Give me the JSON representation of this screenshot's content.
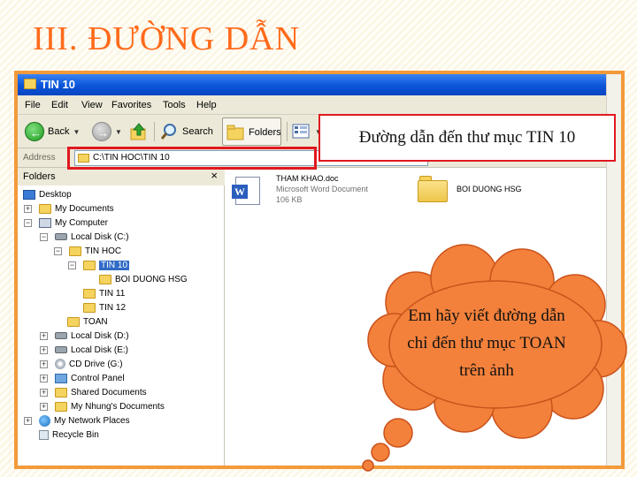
{
  "slide": {
    "title": "III. ĐƯỜNG DẪN"
  },
  "window": {
    "title": "TIN 10"
  },
  "menu": [
    "File",
    "Edit",
    "View",
    "Favorites",
    "Tools",
    "Help"
  ],
  "toolbar": {
    "back": "Back",
    "search": "Search",
    "folders": "Folders"
  },
  "address": {
    "label": "Address",
    "value": "C:\\TIN HOC\\TIN 10"
  },
  "annotation_top": "Đường dẫn đến thư mục TIN 10",
  "folders_pane": {
    "title": "Folders",
    "items": [
      {
        "label": "Desktop",
        "icon": "desktop-icon",
        "expander": ""
      },
      {
        "label": "My Documents",
        "icon": "folder-icon",
        "expander": "+"
      },
      {
        "label": "My Computer",
        "icon": "computer-icon",
        "expander": "−"
      },
      {
        "label": "Local Disk (C:)",
        "icon": "disk-icon",
        "expander": "−"
      },
      {
        "label": "TIN HOC",
        "icon": "folder-icon",
        "expander": "−"
      },
      {
        "label": "TIN 10",
        "icon": "folder-icon",
        "expander": "−"
      },
      {
        "label": "BOI DUONG HSG",
        "icon": "folder-icon",
        "expander": ""
      },
      {
        "label": "TIN 11",
        "icon": "folder-icon",
        "expander": ""
      },
      {
        "label": "TIN 12",
        "icon": "folder-icon",
        "expander": ""
      },
      {
        "label": "TOAN",
        "icon": "folder-icon",
        "expander": ""
      },
      {
        "label": "Local Disk (D:)",
        "icon": "disk-icon",
        "expander": "+"
      },
      {
        "label": "Local Disk (E:)",
        "icon": "disk-icon",
        "expander": "+"
      },
      {
        "label": "CD Drive (G:)",
        "icon": "cd-icon",
        "expander": "+"
      },
      {
        "label": "Control Panel",
        "icon": "control-panel-icon",
        "expander": "+"
      },
      {
        "label": "Shared Documents",
        "icon": "folder-icon",
        "expander": "+"
      },
      {
        "label": "My Nhung's Documents",
        "icon": "folder-icon",
        "expander": "+"
      },
      {
        "label": "My Network Places",
        "icon": "network-icon",
        "expander": "+"
      },
      {
        "label": "Recycle Bin",
        "icon": "recycle-bin-icon",
        "expander": ""
      }
    ]
  },
  "files": [
    {
      "name": "THAM KHAO.doc",
      "type": "Microsoft Word Document",
      "size": "106 KB"
    },
    {
      "name": "BOI DUONG HSG"
    }
  ],
  "thought_bubble": "Em hãy viết đường dẫn chỉ đến thư mục TOAN trên ảnh",
  "colors": {
    "accent": "#f39a3a",
    "title": "#ff6a1a",
    "highlight": "#e0181e",
    "cloud": "#f4813b"
  }
}
